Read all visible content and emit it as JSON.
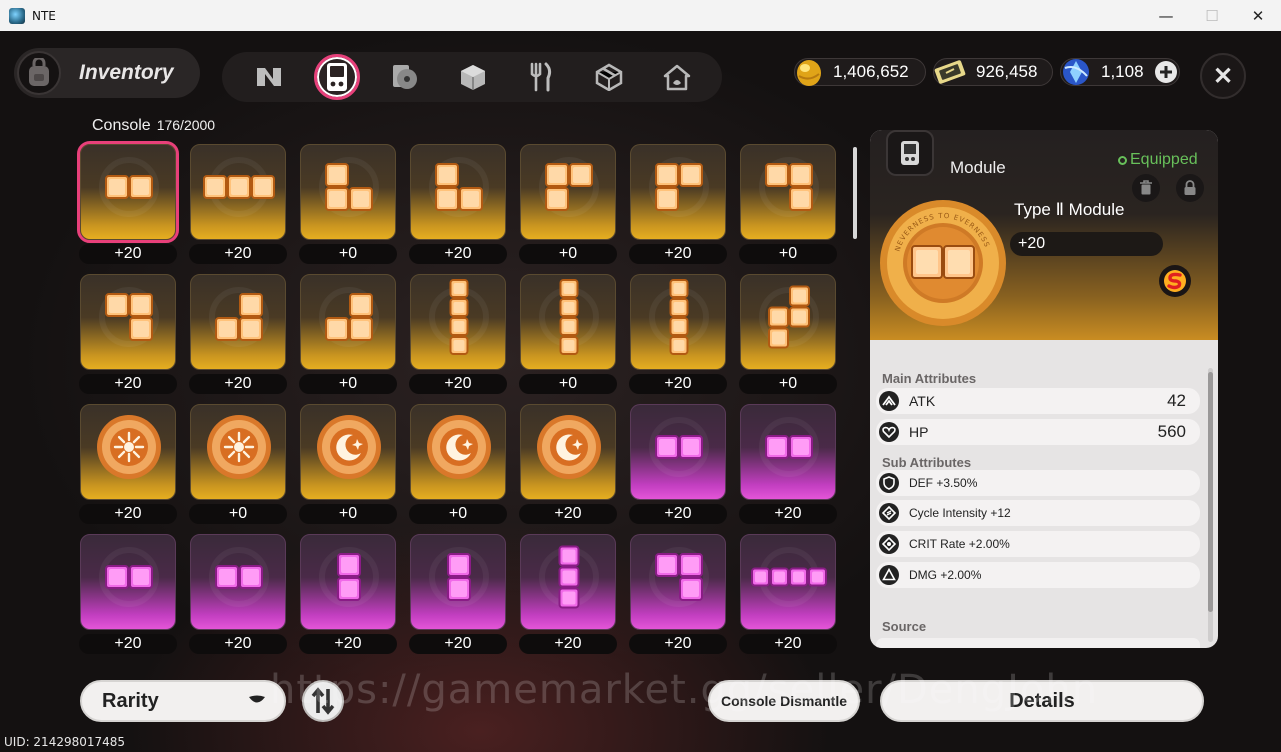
{
  "window": {
    "title": "NTE",
    "minimize": "—",
    "maximize": "☐",
    "close": "✕"
  },
  "header": {
    "title": "Inventory"
  },
  "tabs": [
    {
      "icon": "n-logo-icon"
    },
    {
      "icon": "console-icon",
      "active": true
    },
    {
      "icon": "disc-icon"
    },
    {
      "icon": "cube-icon"
    },
    {
      "icon": "cutlery-icon"
    },
    {
      "icon": "package-icon"
    },
    {
      "icon": "home-icon"
    }
  ],
  "currencies": [
    {
      "icon": "gold-egg-icon",
      "value": "1,406,652"
    },
    {
      "icon": "ticket-icon",
      "value": "926,458"
    },
    {
      "icon": "blue-crystal-icon",
      "value": "1,108"
    }
  ],
  "console": {
    "label": "Console",
    "count": "176/2000"
  },
  "grid": {
    "rows": [
      [
        {
          "shape": "h2",
          "rarity": "gold",
          "level": "+20",
          "selected": true
        },
        {
          "shape": "h3",
          "rarity": "gold",
          "level": "+20"
        },
        {
          "shape": "L",
          "rarity": "gold",
          "level": "+0"
        },
        {
          "shape": "L",
          "rarity": "gold",
          "level": "+20"
        },
        {
          "shape": "Gamma",
          "rarity": "gold",
          "level": "+0"
        },
        {
          "shape": "Gamma",
          "rarity": "gold",
          "level": "+20"
        },
        {
          "shape": "seven",
          "rarity": "gold",
          "level": "+0"
        }
      ],
      [
        {
          "shape": "seven",
          "rarity": "gold",
          "level": "+20"
        },
        {
          "shape": "J",
          "rarity": "gold",
          "level": "+20"
        },
        {
          "shape": "J",
          "rarity": "gold",
          "level": "+0"
        },
        {
          "shape": "v4",
          "rarity": "gold",
          "level": "+20"
        },
        {
          "shape": "v4",
          "rarity": "gold",
          "level": "+0"
        },
        {
          "shape": "v4",
          "rarity": "gold",
          "level": "+20"
        },
        {
          "shape": "S",
          "rarity": "gold",
          "level": "+0"
        }
      ],
      [
        {
          "shape": "coin-sun",
          "rarity": "gold",
          "level": "+20"
        },
        {
          "shape": "coin-sun",
          "rarity": "gold",
          "level": "+0"
        },
        {
          "shape": "coin-moon",
          "rarity": "gold",
          "level": "+0"
        },
        {
          "shape": "coin-moon",
          "rarity": "gold",
          "level": "+0"
        },
        {
          "shape": "coin-moon",
          "rarity": "gold",
          "level": "+20"
        },
        {
          "shape": "h2",
          "rarity": "purple",
          "level": "+20"
        },
        {
          "shape": "h2",
          "rarity": "purple",
          "level": "+20"
        }
      ],
      [
        {
          "shape": "h2",
          "rarity": "purple",
          "level": "+20"
        },
        {
          "shape": "h2",
          "rarity": "purple",
          "level": "+20"
        },
        {
          "shape": "v2",
          "rarity": "purple",
          "level": "+20"
        },
        {
          "shape": "v2",
          "rarity": "purple",
          "level": "+20"
        },
        {
          "shape": "v3",
          "rarity": "purple",
          "level": "+20"
        },
        {
          "shape": "seven",
          "rarity": "purple",
          "level": "+20"
        },
        {
          "shape": "h4",
          "rarity": "purple",
          "level": "+20"
        }
      ]
    ]
  },
  "details": {
    "category": "Module",
    "status": "Equipped",
    "name": "Type Ⅱ Module",
    "level": "+20",
    "medal_text": "NEVERNESS TO EVERNESS",
    "main_title": "Main Attributes",
    "main": [
      {
        "icon": "atk-icon",
        "label": "ATK",
        "value": "42"
      },
      {
        "icon": "hp-icon",
        "label": "HP",
        "value": "560"
      }
    ],
    "sub_title": "Sub Attributes",
    "sub": [
      {
        "icon": "def-icon",
        "label": "DEF +3.50%"
      },
      {
        "icon": "cycle-icon",
        "label": "Cycle Intensity +12"
      },
      {
        "icon": "crit-icon",
        "label": "CRIT Rate +2.00%"
      },
      {
        "icon": "dmg-icon",
        "label": "DMG +2.00%"
      }
    ],
    "source_title": "Source"
  },
  "bottom": {
    "sort_label": "Rarity",
    "dismantle_label": "Console Dismantle",
    "details_label": "Details"
  },
  "uid": "UID: 214298017485",
  "watermark": "https://gamemarket.gg/seller/DengJohn"
}
